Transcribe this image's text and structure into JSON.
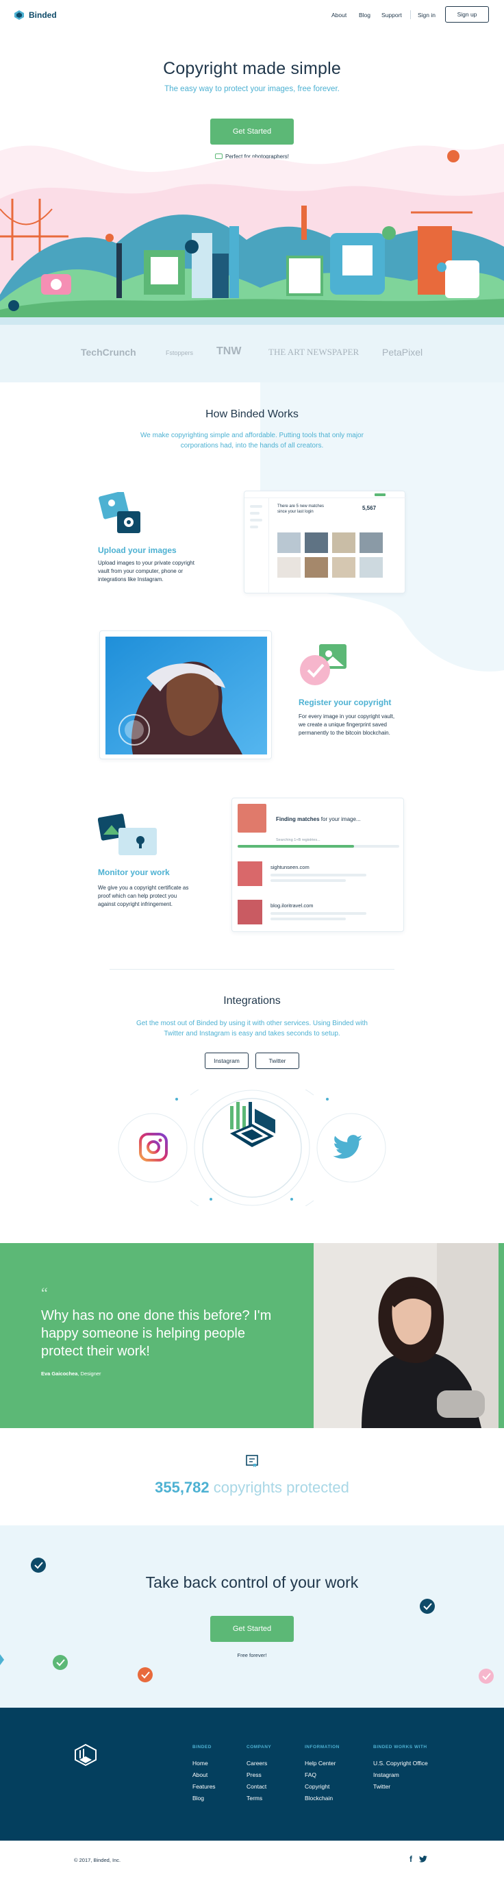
{
  "brand": {
    "name": "Binded"
  },
  "nav": {
    "about": "About",
    "blog": "Blog",
    "support": "Support",
    "signin": "Sign in",
    "signup": "Sign up"
  },
  "hero": {
    "title": "Copyright made simple",
    "subtitle": "The easy way to protect your images, free forever.",
    "cta": "Get Started",
    "note": "Perfect for photographers!"
  },
  "press": [
    "TechCrunch",
    "Fstoppers",
    "TNW",
    "THE ART NEWSPAPER",
    "PetaPixel"
  ],
  "how": {
    "title": "How Binded Works",
    "subtitle_1": "We make copyrighting simple and affordable. Putting tools that only major",
    "subtitle_2": "corporations had, into the hands of all creators."
  },
  "features": [
    {
      "title": "Upload your images",
      "desc_1": "Upload images to your private copyright",
      "desc_2": "vault from your computer, phone or",
      "desc_3": "integrations like Instagram."
    },
    {
      "title": "Register your copyright",
      "desc_1": "For every image in your copyright vault,",
      "desc_2": "we create a unique fingerprint saved",
      "desc_3": "permanently to the bitcoin blockchain."
    },
    {
      "title": "Monitor your work",
      "desc_1": "We give you a copyright certificate as",
      "desc_2": "proof which can help protect you",
      "desc_3": "against copyright infringement."
    }
  ],
  "mock_upload": {
    "matches_1": "There are 5 new matches",
    "matches_2": "since your last login",
    "count": "5,567"
  },
  "mock_monitor": {
    "finding_bold": "Finding matches",
    "finding_rest": " for your image...",
    "searching": "Searching 1+B registries...",
    "result_1": "sightunseen.com",
    "result_2": "blog.iloritravel.com"
  },
  "integrations": {
    "title": "Integrations",
    "subtitle_1": "Get the most out of Binded by using it with other services. Using Binded with",
    "subtitle_2": "Twitter and Instagram is easy and takes seconds to setup.",
    "instagram": "Instagram",
    "twitter": "Twitter"
  },
  "testimonial": {
    "quote": "Why has no one done this before? I'm happy someone is helping people protect their work!",
    "author": "Eva Gaicochea",
    "role": ", Designer"
  },
  "stats": {
    "count": "355,782",
    "label": " copyrights protected"
  },
  "bottom_cta": {
    "title": "Take back control of your work",
    "cta": "Get Started",
    "note": "Free forever!"
  },
  "footer": {
    "columns": [
      {
        "heading": "BINDED",
        "links": [
          "Home",
          "About",
          "Features",
          "Blog"
        ]
      },
      {
        "heading": "COMPANY",
        "links": [
          "Careers",
          "Press",
          "Contact",
          "Terms"
        ]
      },
      {
        "heading": "INFORMATION",
        "links": [
          "Help Center",
          "FAQ",
          "Copyright",
          "Blockchain"
        ]
      },
      {
        "heading": "BINDED WORKS WITH",
        "links": [
          "U.S. Copyright Office",
          "Instagram",
          "Twitter"
        ]
      }
    ],
    "copyright": "© 2017, Binded, Inc."
  },
  "colors": {
    "green": "#5cb876",
    "blue": "#4db1d2",
    "navy": "#043f5e",
    "text": "#21384c"
  }
}
